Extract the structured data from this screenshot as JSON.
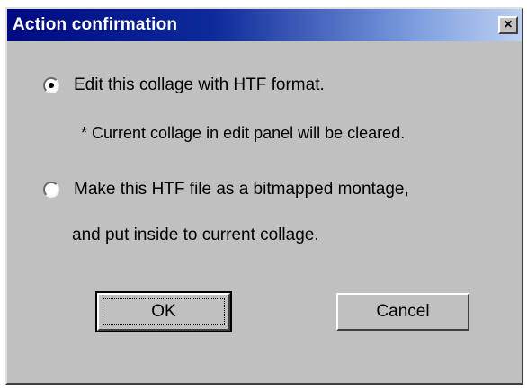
{
  "dialog": {
    "title": "Action confirmation",
    "close_glyph": "×",
    "options": [
      {
        "label": "Edit this collage with HTF format.",
        "selected": true
      },
      {
        "label": "Make this HTF file as a bitmapped montage,",
        "selected": false
      }
    ],
    "note": "* Current collage in edit panel will be cleared.",
    "option2_continuation": "and put inside to current collage.",
    "ok_label": "OK",
    "cancel_label": "Cancel"
  }
}
